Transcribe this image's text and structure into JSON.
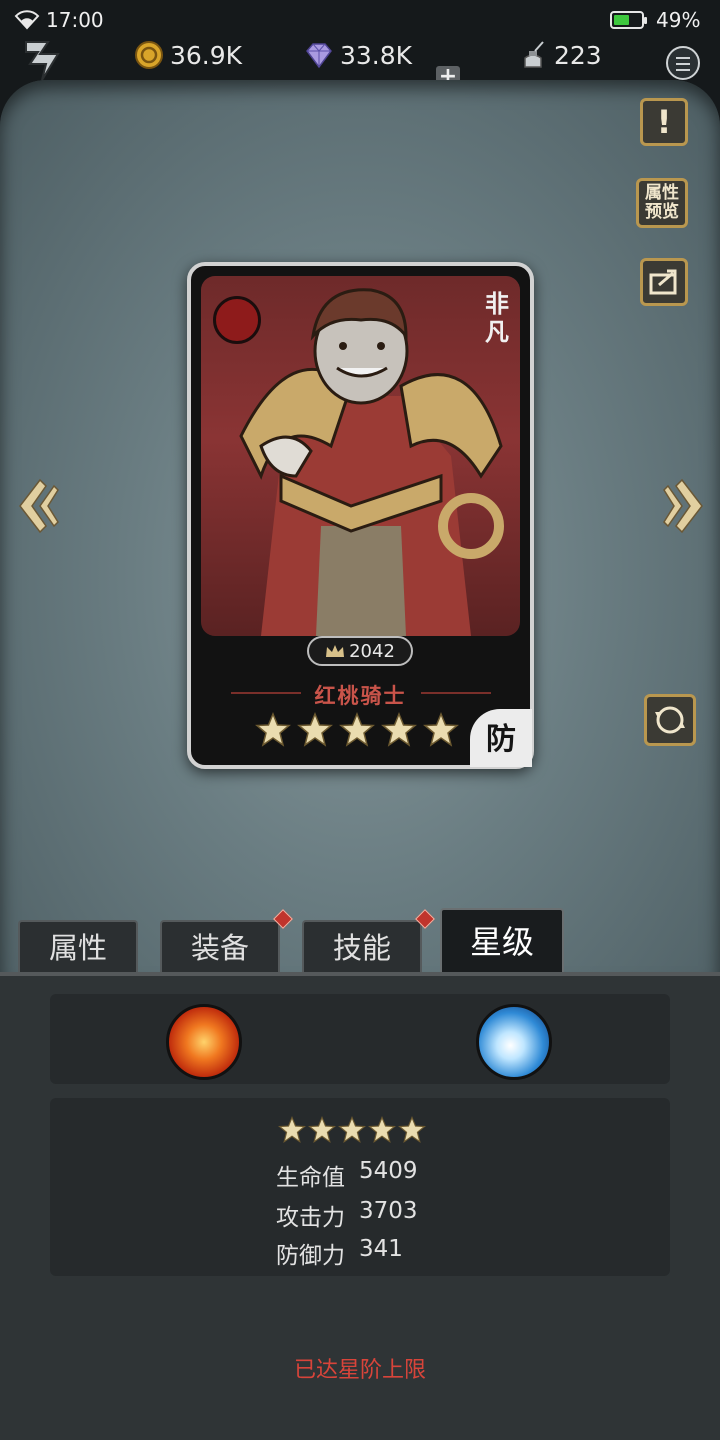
{
  "status_bar": {
    "time": "17:00",
    "battery_percent": "49%",
    "battery_level": 0.49
  },
  "topbar": {
    "gold": "36.9K",
    "diamonds": "33.8K",
    "plus": "+",
    "stamina": "223"
  },
  "side_buttons": {
    "info": "!",
    "attr_preview": "属性预览"
  },
  "card": {
    "rarity": "非凡",
    "power": "2042",
    "name": "红桃骑士",
    "stars": 5,
    "role": "防"
  },
  "tabs": [
    {
      "label": "属性",
      "active": false,
      "badge": false
    },
    {
      "label": "装备",
      "active": false,
      "badge": true
    },
    {
      "label": "技能",
      "active": false,
      "badge": true
    },
    {
      "label": "星级",
      "active": true,
      "badge": false
    }
  ],
  "star_panel": {
    "elements": [
      "fire-orb",
      "water-orb"
    ],
    "stars": 5,
    "stats": [
      {
        "label": "生命值",
        "value": "5409"
      },
      {
        "label": "攻击力",
        "value": "3703"
      },
      {
        "label": "防御力",
        "value": "341"
      }
    ],
    "max_text": "已达星阶上限"
  },
  "colors": {
    "accent_gold": "#b9974f",
    "card_name": "#c9544a",
    "warning": "#d8443a",
    "badge_red": "#c0342c"
  }
}
